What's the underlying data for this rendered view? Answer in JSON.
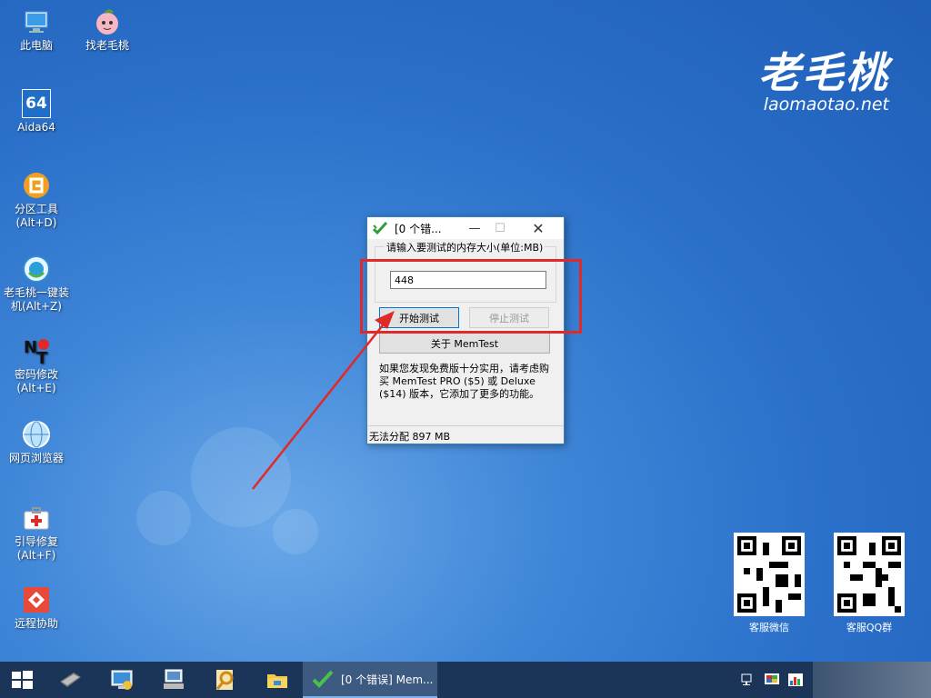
{
  "desktop": {
    "icons": [
      {
        "label": "此电脑"
      },
      {
        "label": "找老毛桃"
      },
      {
        "label": "Aida64",
        "glyph": "64"
      },
      {
        "label": "分区工具",
        "label2": "(Alt+D)"
      },
      {
        "label": "老毛桃一键装",
        "label2": "机(Alt+Z)"
      },
      {
        "label": "密码修改",
        "label2": "(Alt+E)"
      },
      {
        "label": "网页浏览器"
      },
      {
        "label": "引导修复",
        "label2": "(Alt+F)"
      },
      {
        "label": "远程协助"
      }
    ],
    "logo": {
      "title": "老毛桃",
      "domain": "laomaotao.net"
    },
    "qr_codes": [
      {
        "label": "客服微信"
      },
      {
        "label": "客服QQ群"
      }
    ]
  },
  "window": {
    "title": "[0 个错...",
    "min_glyph": "—",
    "max_glyph": "☐",
    "close_glyph": "✕",
    "group_label": "请输入要测试的内存大小(单位:MB)",
    "mem_value": "448",
    "start_label": "开始测试",
    "stop_label": "停止测试",
    "about_label": "关于 MemTest",
    "info_text": "如果您发现免费版十分实用，请考虑购买 MemTest PRO ($5) 或 Deluxe ($14) 版本，它添加了更多的功能。",
    "status_text": "无法分配 897 MB"
  },
  "taskbar": {
    "active_label": "[0 个错误] Mem..."
  },
  "colors": {
    "highlight_box": "#e02a2a",
    "taskbar": "#1a3558"
  }
}
